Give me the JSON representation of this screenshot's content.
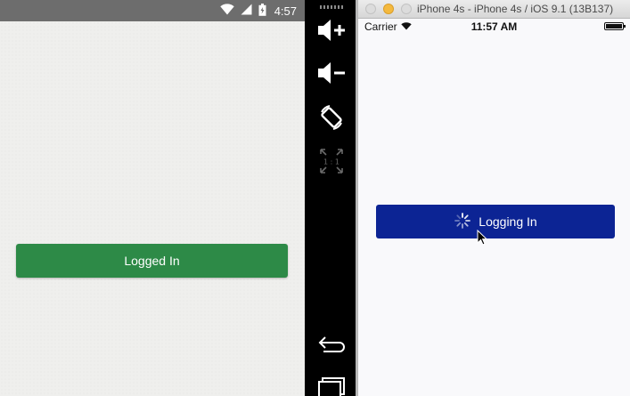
{
  "android": {
    "status_bar": {
      "time": "4:57",
      "icons": [
        "wifi-icon",
        "signal-icon",
        "battery-icon"
      ]
    },
    "button": {
      "label": "Logged In",
      "color": "#2d8a47"
    }
  },
  "emulator_toolbar": {
    "icons": [
      "volume-up-icon",
      "volume-down-icon",
      "rotate-icon",
      "scale-1-1-icon",
      "back-icon",
      "recent-apps-icon"
    ],
    "scale_label": "1 : 1"
  },
  "ios_simulator": {
    "window_title": "iPhone 4s - iPhone 4s / iOS 9.1 (13B137)",
    "status_bar": {
      "carrier": "Carrier",
      "time": "11:57 AM"
    },
    "button": {
      "label": "Logging In",
      "color": "#0c2494"
    }
  }
}
